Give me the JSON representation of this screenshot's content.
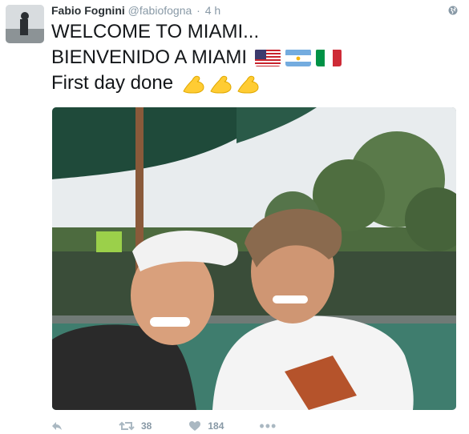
{
  "tweet": {
    "author_name": "Fabio Fognini",
    "handle": "@fabiofogna",
    "separator": "·",
    "time": "4 h",
    "lines": [
      "WELCOME TO MIAMI...",
      "BIENVENIDO A MIAMI",
      "First day done"
    ],
    "flags": [
      "us-flag-icon",
      "argentina-flag-icon",
      "italy-flag-icon"
    ],
    "emoji": [
      "flexed-biceps-icon",
      "flexed-biceps-icon",
      "flexed-biceps-icon"
    ]
  },
  "actions": {
    "retweet_count": "38",
    "like_count": "184",
    "more_label": "•••"
  },
  "colors": {
    "text": "#14171a",
    "muted": "#8899a6",
    "action": "#aab8c2"
  }
}
